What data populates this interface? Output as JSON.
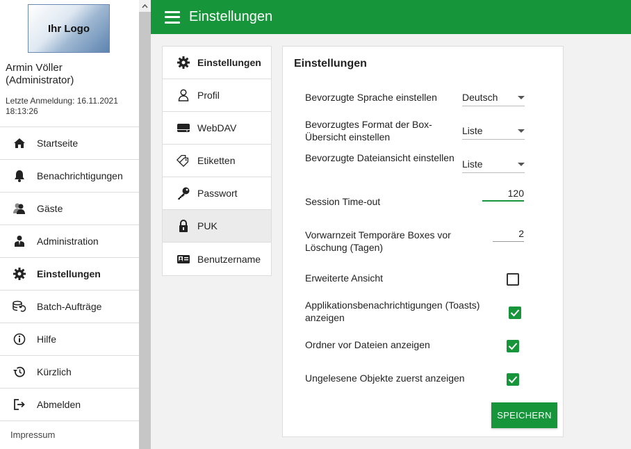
{
  "sidebar": {
    "logo_text": "Ihr Logo",
    "user_name": "Armin Völler",
    "user_role": "(Administrator)",
    "last_login": "Letzte Anmeldung: 16.11.2021 18:13:26",
    "items": [
      {
        "label": "Startseite",
        "icon": "home-icon"
      },
      {
        "label": "Benachrichtigungen",
        "icon": "bell-icon"
      },
      {
        "label": "Gäste",
        "icon": "guests-icon"
      },
      {
        "label": "Administration",
        "icon": "admin-user-icon"
      },
      {
        "label": "Einstellungen",
        "icon": "gear-icon",
        "active": true
      },
      {
        "label": "Batch-Aufträge",
        "icon": "batch-icon"
      },
      {
        "label": "Hilfe",
        "icon": "info-icon"
      },
      {
        "label": "Kürzlich",
        "icon": "history-icon"
      },
      {
        "label": "Abmelden",
        "icon": "logout-icon"
      }
    ],
    "impressum": "Impressum"
  },
  "header": {
    "title": "Einstellungen"
  },
  "settings_nav": {
    "items": [
      {
        "label": "Einstellungen",
        "icon": "gear-icon",
        "active": true
      },
      {
        "label": "Profil",
        "icon": "person-icon"
      },
      {
        "label": "WebDAV",
        "icon": "drive-icon"
      },
      {
        "label": "Etiketten",
        "icon": "tags-icon"
      },
      {
        "label": "Passwort",
        "icon": "key-icon"
      },
      {
        "label": "PUK",
        "icon": "lock-icon",
        "selected": true
      },
      {
        "label": "Benutzername",
        "icon": "id-card-icon"
      }
    ]
  },
  "card": {
    "title": "Einstellungen",
    "language": {
      "label": "Bevorzugte Sprache einstellen",
      "value": "Deutsch"
    },
    "box_format": {
      "label": "Bevorzugtes Format der Box-Übersicht einstellen",
      "value": "Liste"
    },
    "file_view": {
      "label": "Bevorzugte Dateiansicht einstellen",
      "value": "Liste"
    },
    "session_timeout": {
      "label": "Session Time-out",
      "value": "120"
    },
    "warning_time": {
      "label": "Vorwarnzeit Temporäre Boxes vor Löschung (Tagen)",
      "value": "2"
    },
    "extended_view": {
      "label": "Erweiterte Ansicht",
      "checked": false
    },
    "toasts": {
      "label": "Applikationsbenachrichtigungen (Toasts) anzeigen",
      "checked": true
    },
    "folders_first": {
      "label": "Ordner vor Dateien anzeigen",
      "checked": true
    },
    "unread_first": {
      "label": "Ungelesene Objekte zuerst anzeigen",
      "checked": true
    },
    "save_label": "SPEICHERN"
  },
  "colors": {
    "accent": "#16953a"
  }
}
